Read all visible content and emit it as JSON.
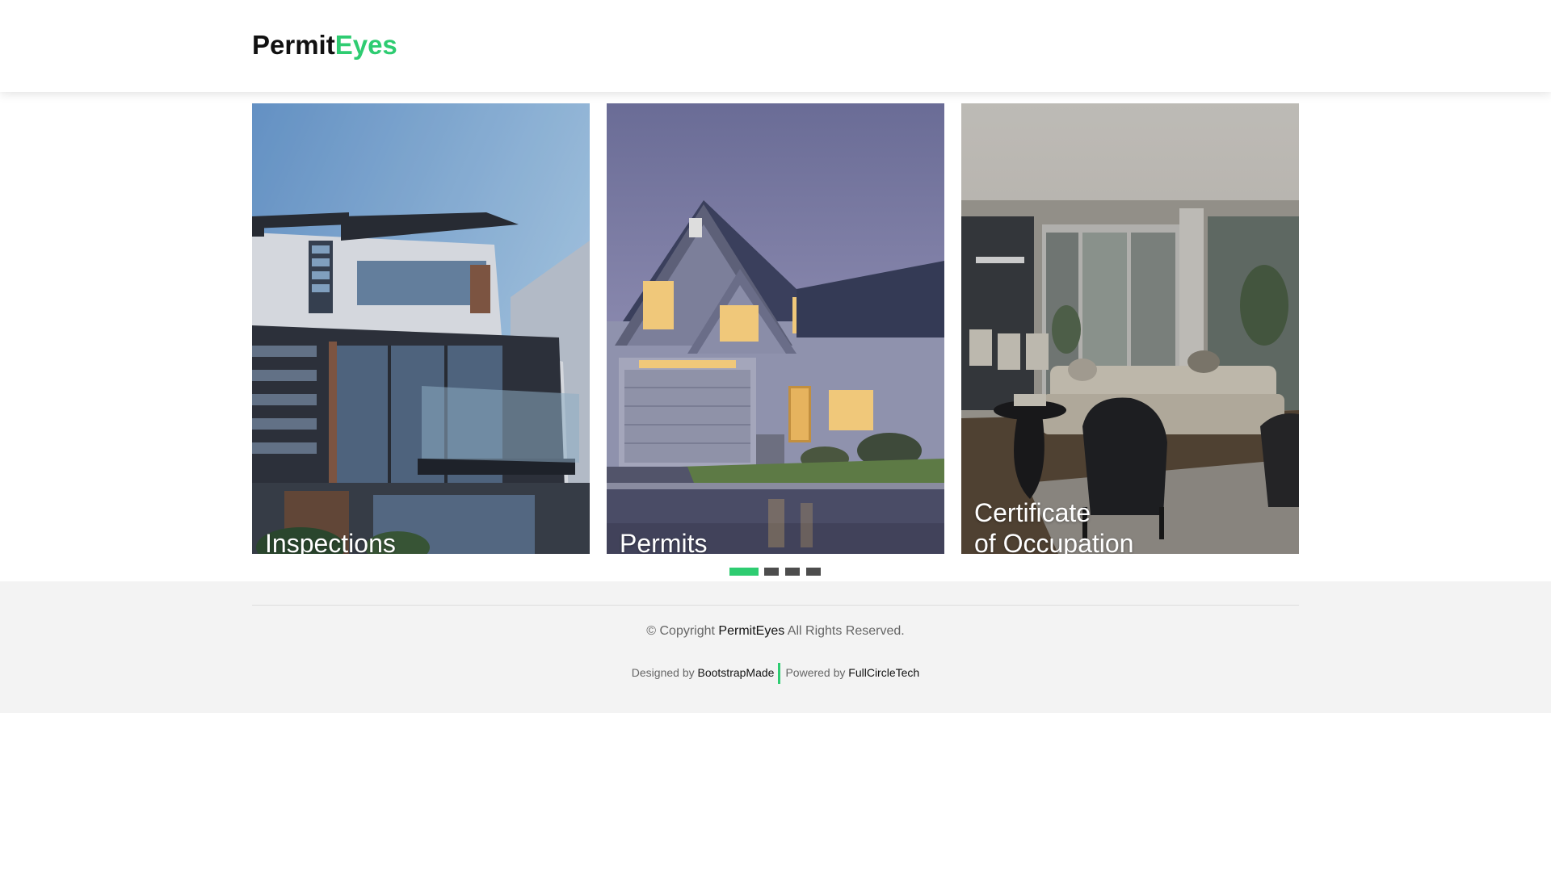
{
  "header": {
    "logo_part1": "Permit",
    "logo_part2": "Eyes",
    "accent_color": "#2ecc71"
  },
  "services": [
    {
      "title_line1": "Inspections",
      "title_line2": ""
    },
    {
      "title_line1": "Permits",
      "title_line2": ""
    },
    {
      "title_line1": "Certificate",
      "title_line2": "of Occupation"
    }
  ],
  "carousel": {
    "page_count": 4,
    "active_index": 0
  },
  "footer": {
    "copyright_prefix": "© Copyright",
    "copyright_brand": "PermitEyes",
    "copyright_suffix": "All Rights Reserved.",
    "designed_by_label": "Designed by",
    "designed_by_link": "BootstrapMade",
    "powered_by_label": "Powered by",
    "powered_by_link": "FullCircleTech"
  }
}
